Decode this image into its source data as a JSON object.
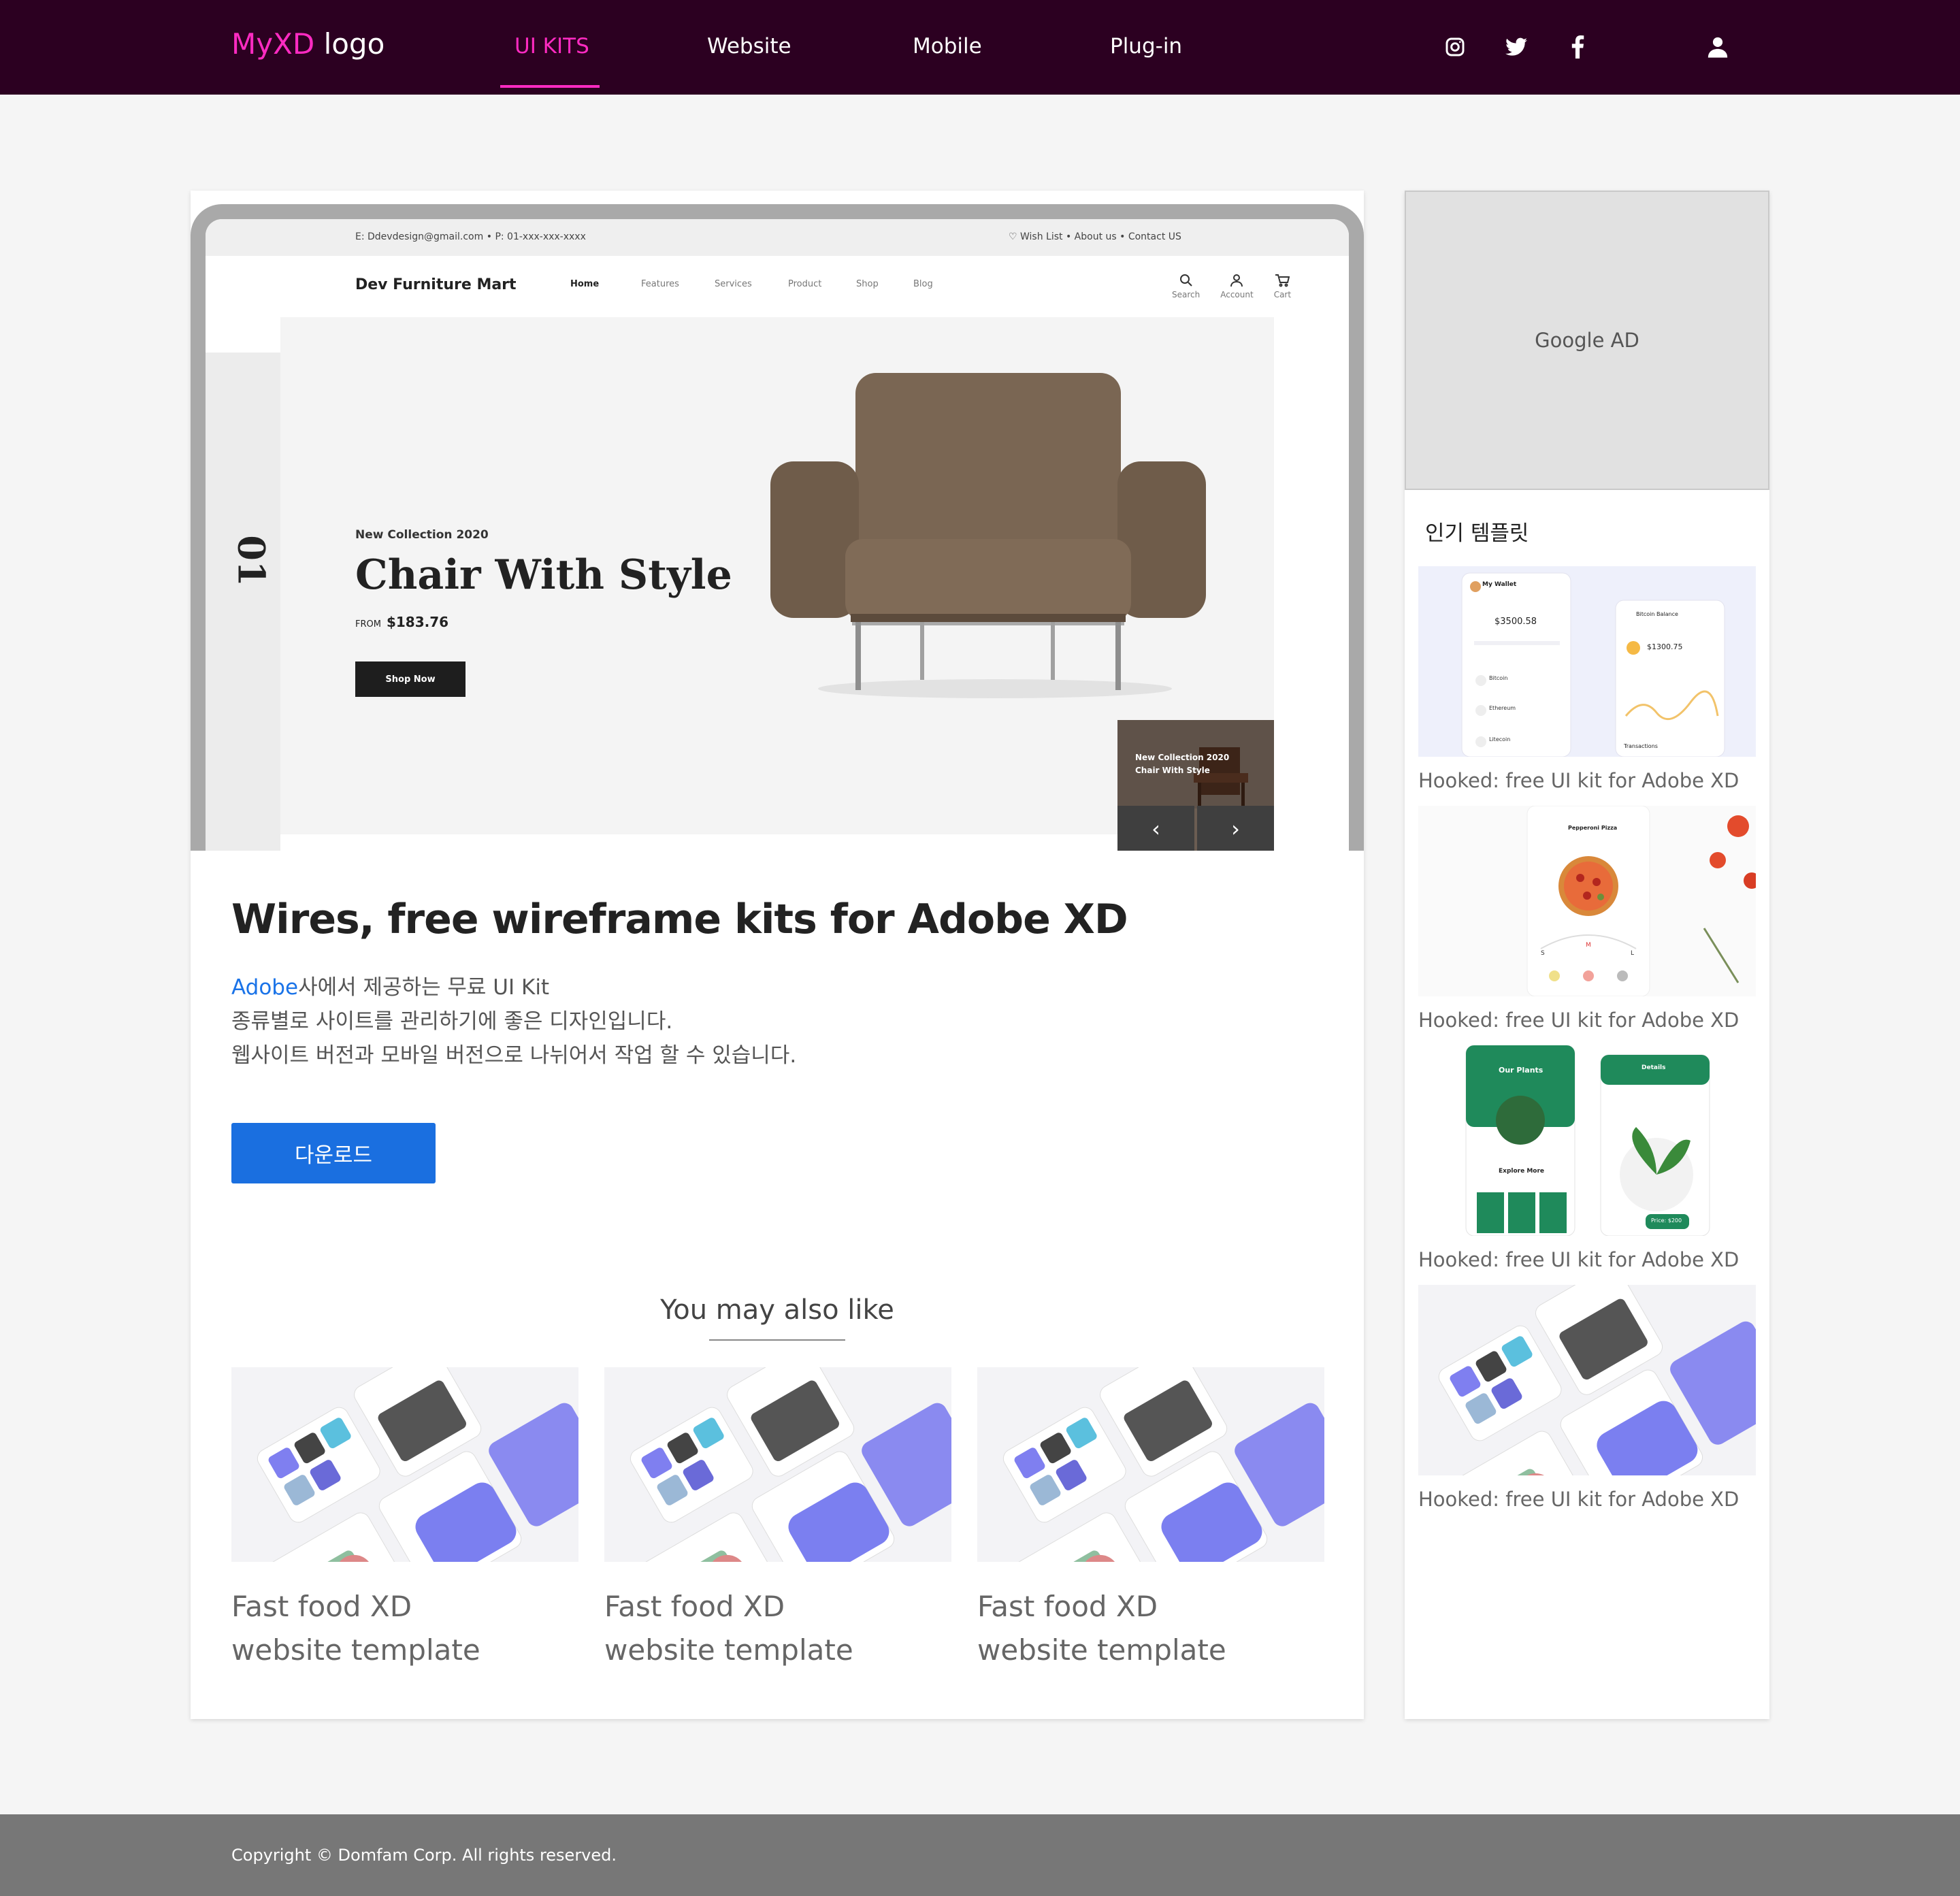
{
  "header": {
    "logo_brand": "MyXD",
    "logo_suffix": " logo",
    "nav": [
      {
        "label": "UI KITS",
        "active": true
      },
      {
        "label": "Website",
        "active": false
      },
      {
        "label": "Mobile",
        "active": false
      },
      {
        "label": "Plug-in",
        "active": false
      }
    ],
    "social_icons": [
      "instagram-icon",
      "twitter-icon",
      "facebook-icon"
    ],
    "user_icon": "user-icon",
    "accent": "#ff2bc2",
    "bg": "#2c0021"
  },
  "hero_mockup": {
    "top_email": "E: Ddevdesign@gmail.com",
    "top_phone": "P: 01-xxx-xxx-xxxx",
    "top_links": "♡ Wish List  •  About us  •  Contact US",
    "brand": "Dev Furniture Mart",
    "links": [
      "Home",
      "Features",
      "Services",
      "Product",
      "Shop",
      "Blog"
    ],
    "icons": [
      "Search",
      "Account",
      "Cart"
    ],
    "slide_number": "01",
    "collection": "New Collection 2020",
    "title": "Chair With Style",
    "price_prefix": "FROM",
    "price": "$183.76",
    "shop_button": "Shop Now",
    "thumb_line1": "New Collection 2020",
    "thumb_line2": "Chair With Style",
    "prev": "‹",
    "next": "›"
  },
  "main": {
    "title": "Wires, free wireframe kits for Adobe XD",
    "desc_link": "Adobe",
    "desc_line1_rest": "사에서 제공하는 무료 UI Kit",
    "desc_line2": "종류별로 사이트를 관리하기에 좋은 디자인입니다.",
    "desc_line3": "웹사이트 버전과 모바일 버전으로 나뉘어서 작업 할 수 있습니다.",
    "download_label": "다운로드"
  },
  "related": {
    "heading": "You may also like",
    "items": [
      {
        "line1": "Fast food XD",
        "line2": "website template"
      },
      {
        "line1": "Fast food XD",
        "line2": "website template"
      },
      {
        "line1": "Fast food XD",
        "line2": "website template"
      }
    ]
  },
  "sidebar": {
    "ad_label": "Google AD",
    "popular_title": "인기 템플릿",
    "items": [
      {
        "caption": "Hooked: free UI kit for Adobe XD"
      },
      {
        "caption": "Hooked: free UI kit for Adobe XD"
      },
      {
        "caption": "Hooked: free UI kit for Adobe XD"
      },
      {
        "caption": "Hooked: free UI kit for Adobe XD"
      }
    ],
    "wallet": {
      "title": "My Wallet",
      "balance": "$3500.58",
      "rows": [
        "Bitcoin",
        "Ethereum",
        "Litecoin"
      ],
      "card2_title": "Bitcoin Balance",
      "card2_value": "$1300.75",
      "card2_footer": "Transactions"
    },
    "pizza": {
      "title": "Pepperoni Pizza",
      "sizes": [
        "S",
        "M",
        "L"
      ]
    },
    "plants": {
      "title": "Our Plants",
      "explore": "Explore More",
      "details": "Details",
      "price": "Price: $200"
    }
  },
  "footer": {
    "copyright": "Copyright © Domfam Corp. All rights reserved."
  }
}
